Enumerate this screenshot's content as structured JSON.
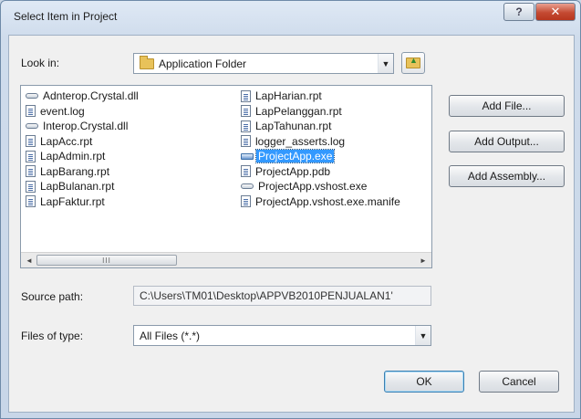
{
  "window": {
    "title": "Select Item in Project",
    "help_label": "?",
    "close_label": "✕"
  },
  "look_in": {
    "label": "Look in:",
    "value": "Application Folder"
  },
  "files": {
    "column1": [
      {
        "name": "Adnterop.Crystal.dll",
        "icon": "dll-icon"
      },
      {
        "name": "event.log",
        "icon": "document-icon"
      },
      {
        "name": "Interop.Crystal.dll",
        "icon": "dll-icon"
      },
      {
        "name": "LapAcc.rpt",
        "icon": "document-icon"
      },
      {
        "name": "LapAdmin.rpt",
        "icon": "document-icon"
      },
      {
        "name": "LapBarang.rpt",
        "icon": "document-icon"
      },
      {
        "name": "LapBulanan.rpt",
        "icon": "document-icon"
      },
      {
        "name": "LapFaktur.rpt",
        "icon": "document-icon"
      }
    ],
    "column2": [
      {
        "name": "LapHarian.rpt",
        "icon": "document-icon"
      },
      {
        "name": "LapPelanggan.rpt",
        "icon": "document-icon"
      },
      {
        "name": "LapTahunan.rpt",
        "icon": "document-icon"
      },
      {
        "name": "logger_asserts.log",
        "icon": "document-icon"
      },
      {
        "name": "ProjectApp.exe",
        "icon": "exe-icon",
        "selected": true
      },
      {
        "name": "ProjectApp.pdb",
        "icon": "document-icon"
      },
      {
        "name": "ProjectApp.vshost.exe",
        "icon": "dll-icon"
      },
      {
        "name": "ProjectApp.vshost.exe.manife",
        "icon": "document-icon"
      }
    ]
  },
  "scrollbar": {
    "left_arrow": "◄",
    "right_arrow": "►",
    "thumb_grip": "III"
  },
  "buttons": {
    "add_file": "Add File...",
    "add_output": "Add Output...",
    "add_assembly": "Add Assembly...",
    "ok": "OK",
    "cancel": "Cancel"
  },
  "source_path": {
    "label": "Source path:",
    "value": "C:\\Users\\TM01\\Desktop\\APPVB2010PENJUALAN1'"
  },
  "files_of_type": {
    "label": "Files of type:",
    "value": "All Files (*.*)"
  },
  "colors": {
    "selection": "#3399ff",
    "close_button": "#c44a32"
  }
}
